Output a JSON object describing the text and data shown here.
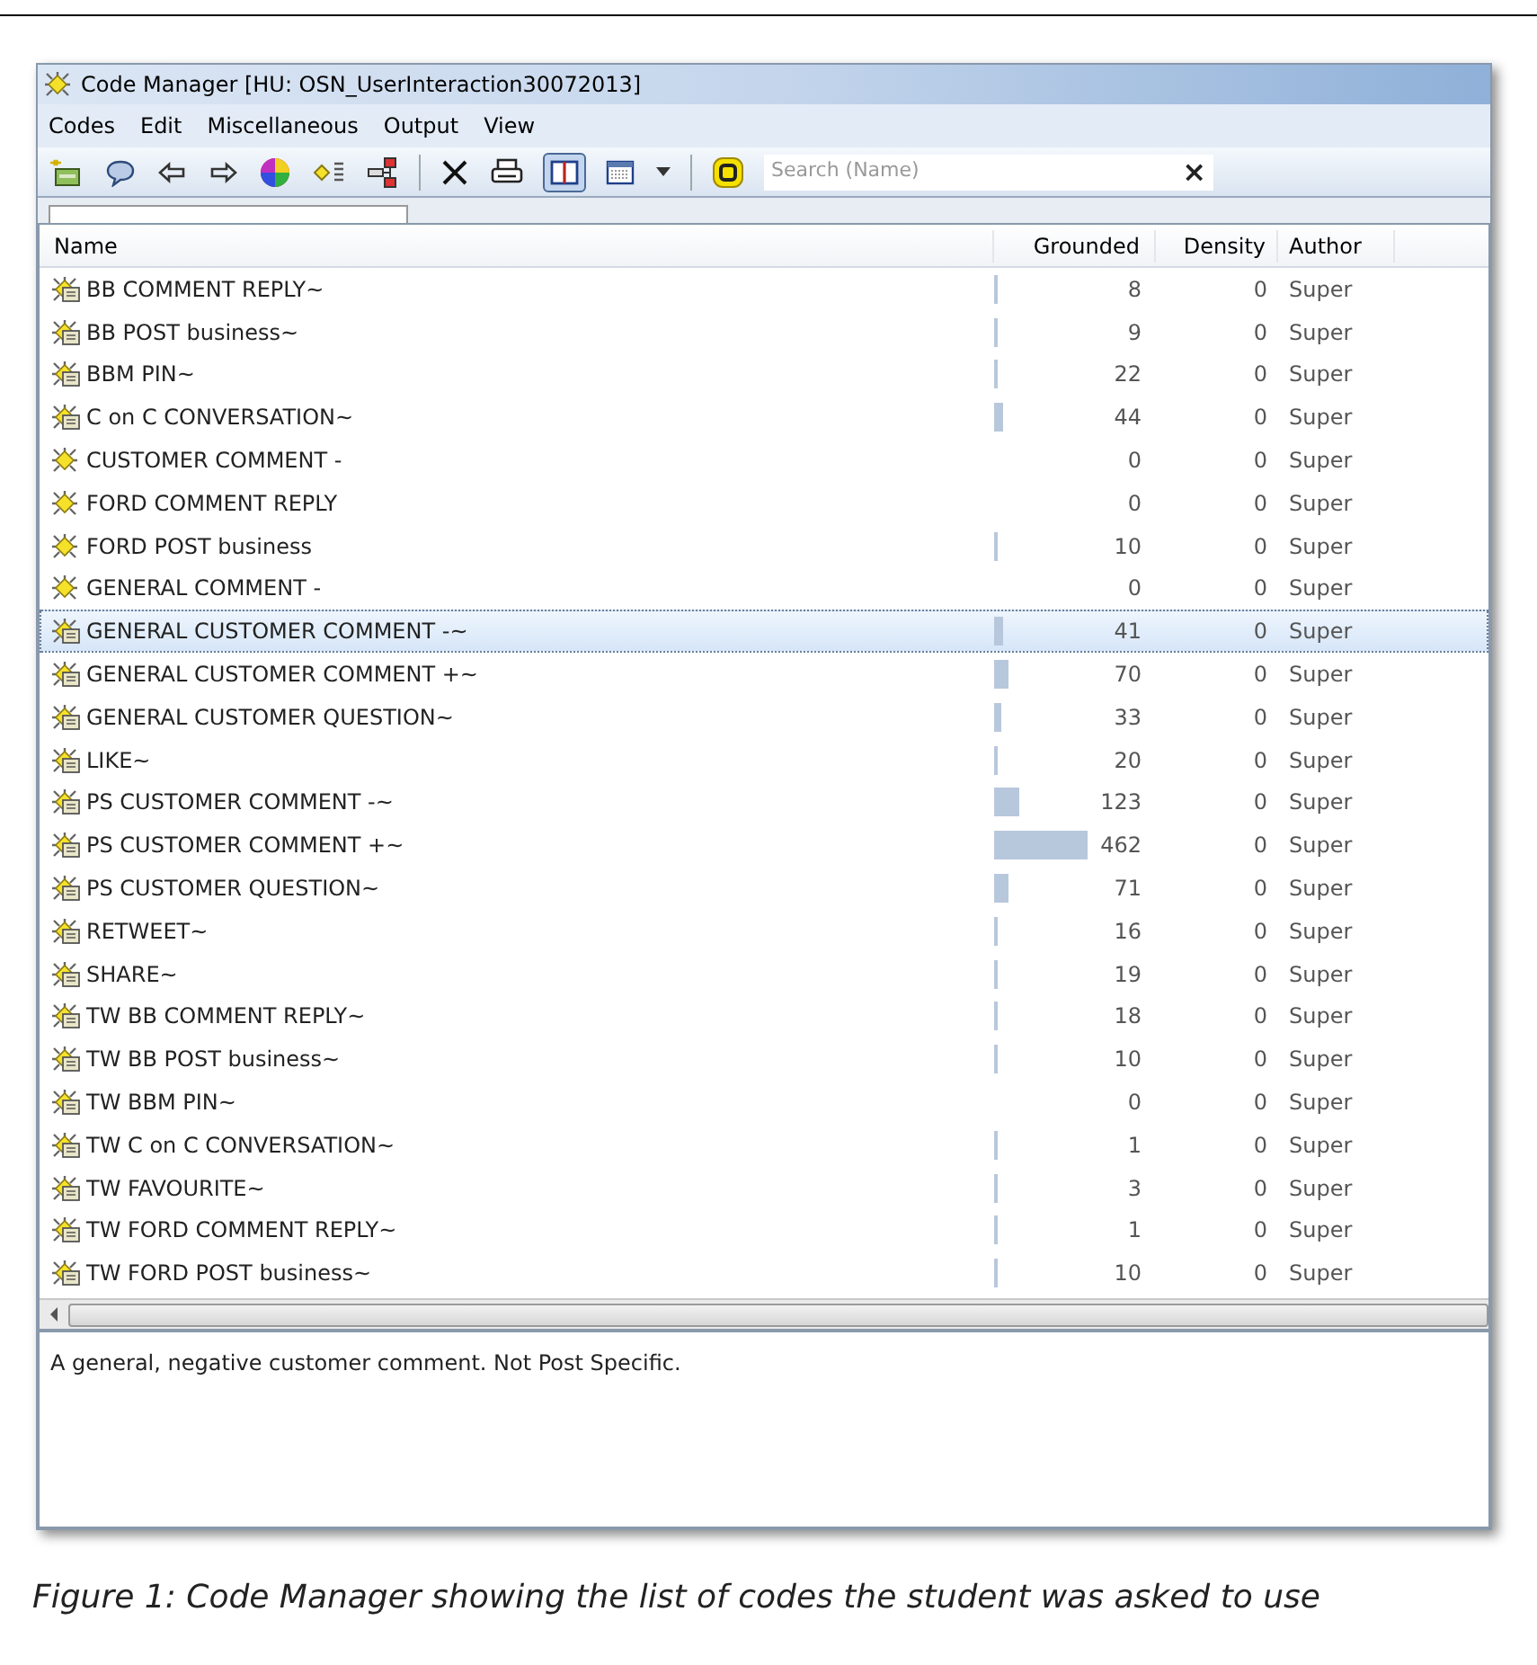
{
  "window": {
    "title": "Code Manager [HU: OSN_UserInteraction30072013]"
  },
  "menu": [
    "Codes",
    "Edit",
    "Miscellaneous",
    "Output",
    "View"
  ],
  "toolbar_groups": [
    [
      {
        "kind": "new-code",
        "pressed": false
      },
      {
        "kind": "comment",
        "pressed": false
      },
      {
        "kind": "back",
        "pressed": false
      },
      {
        "kind": "forward",
        "pressed": false
      },
      {
        "kind": "color",
        "pressed": false
      },
      {
        "kind": "code-list",
        "pressed": false
      },
      {
        "kind": "tree",
        "pressed": false
      }
    ],
    [
      {
        "kind": "delete",
        "pressed": false
      },
      {
        "kind": "print",
        "pressed": false
      },
      {
        "kind": "split-view",
        "pressed": true
      },
      {
        "kind": "grid-view",
        "pressed": false
      },
      {
        "kind": "dropdown",
        "pressed": false
      }
    ],
    [
      {
        "kind": "filter",
        "pressed": false
      }
    ]
  ],
  "search": {
    "placeholder": "Search (Name)",
    "clear": "×"
  },
  "table": {
    "columns": [
      "Name",
      "Grounded",
      "Density",
      "Author"
    ],
    "rows": [
      {
        "name": "BB COMMENT REPLY~",
        "kind": "memo",
        "grounded": "8",
        "density": "0",
        "author": "Super",
        "selected": false
      },
      {
        "name": "BB POST business~",
        "kind": "memo",
        "grounded": "9",
        "density": "0",
        "author": "Super",
        "selected": false
      },
      {
        "name": "BBM PIN~",
        "kind": "memo",
        "grounded": "22",
        "density": "0",
        "author": "Super",
        "selected": false
      },
      {
        "name": "C on C CONVERSATION~",
        "kind": "memo",
        "grounded": "44",
        "density": "0",
        "author": "Super",
        "selected": false
      },
      {
        "name": "CUSTOMER COMMENT -",
        "kind": "plain",
        "grounded": "0",
        "density": "0",
        "author": "Super",
        "selected": false
      },
      {
        "name": "FORD COMMENT REPLY",
        "kind": "plain",
        "grounded": "0",
        "density": "0",
        "author": "Super",
        "selected": false
      },
      {
        "name": "FORD POST business",
        "kind": "plain",
        "grounded": "10",
        "density": "0",
        "author": "Super",
        "selected": false
      },
      {
        "name": "GENERAL COMMENT -",
        "kind": "plain",
        "grounded": "0",
        "density": "0",
        "author": "Super",
        "selected": false
      },
      {
        "name": "GENERAL CUSTOMER COMMENT -~",
        "kind": "memo",
        "grounded": "41",
        "density": "0",
        "author": "Super",
        "selected": true
      },
      {
        "name": "GENERAL CUSTOMER COMMENT +~",
        "kind": "memo",
        "grounded": "70",
        "density": "0",
        "author": "Super",
        "selected": false
      },
      {
        "name": "GENERAL CUSTOMER QUESTION~",
        "kind": "memo",
        "grounded": "33",
        "density": "0",
        "author": "Super",
        "selected": false
      },
      {
        "name": "LIKE~",
        "kind": "memo",
        "grounded": "20",
        "density": "0",
        "author": "Super",
        "selected": false
      },
      {
        "name": "PS CUSTOMER COMMENT -~",
        "kind": "memo",
        "grounded": "123",
        "density": "0",
        "author": "Super",
        "selected": false
      },
      {
        "name": "PS CUSTOMER COMMENT +~",
        "kind": "memo",
        "grounded": "462",
        "density": "0",
        "author": "Super",
        "selected": false
      },
      {
        "name": "PS CUSTOMER QUESTION~",
        "kind": "memo",
        "grounded": "71",
        "density": "0",
        "author": "Super",
        "selected": false
      },
      {
        "name": "RETWEET~",
        "kind": "memo",
        "grounded": "16",
        "density": "0",
        "author": "Super",
        "selected": false
      },
      {
        "name": "SHARE~",
        "kind": "memo",
        "grounded": "19",
        "density": "0",
        "author": "Super",
        "selected": false
      },
      {
        "name": "TW BB COMMENT REPLY~",
        "kind": "memo",
        "grounded": "18",
        "density": "0",
        "author": "Super",
        "selected": false
      },
      {
        "name": "TW BB POST business~",
        "kind": "memo",
        "grounded": "10",
        "density": "0",
        "author": "Super",
        "selected": false
      },
      {
        "name": "TW BBM PIN~",
        "kind": "memo",
        "grounded": "0",
        "density": "0",
        "author": "Super",
        "selected": false
      },
      {
        "name": "TW C on C CONVERSATION~",
        "kind": "memo",
        "grounded": "1",
        "density": "0",
        "author": "Super",
        "selected": false
      },
      {
        "name": "TW FAVOURITE~",
        "kind": "memo",
        "grounded": "3",
        "density": "0",
        "author": "Super",
        "selected": false
      },
      {
        "name": "TW FORD COMMENT REPLY~",
        "kind": "memo",
        "grounded": "1",
        "density": "0",
        "author": "Super",
        "selected": false
      },
      {
        "name": "TW FORD POST business~",
        "kind": "memo",
        "grounded": "10",
        "density": "0",
        "author": "Super",
        "selected": false
      }
    ]
  },
  "comment": "A general, negative customer comment. Not Post Specific.",
  "caption": "Figure 1: Code Manager showing the list of codes the student was asked to use"
}
